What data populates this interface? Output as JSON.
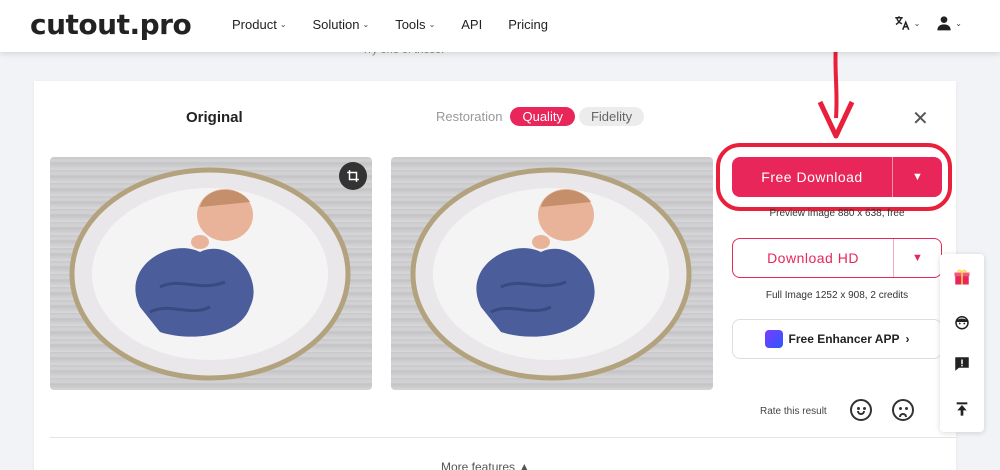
{
  "header": {
    "logo": "cutout.pro",
    "nav": [
      "Product",
      "Solution",
      "Tools",
      "API",
      "Pricing"
    ],
    "nav_has_caret": [
      true,
      true,
      true,
      false,
      false
    ]
  },
  "try_one": "Try one of these:",
  "card": {
    "original_title": "Original",
    "tabs": {
      "label": "Restoration",
      "active": "Quality",
      "inactive": "Fidelity"
    }
  },
  "panel": {
    "free_download": "Free Download",
    "preview_note": "Preview image 880 x 638, free",
    "download_hd": "Download HD",
    "full_note": "Full Image 1252 x 908, 2 credits",
    "app_button": "Free Enhancer APP",
    "app_chevron": "›",
    "rate_label": "Rate this result"
  },
  "more_features": "More features",
  "colors": {
    "accent": "#e8265a",
    "highlight": "#e8203c"
  },
  "icons": [
    "translate-icon",
    "user-icon",
    "crop-icon",
    "close-icon",
    "gift-icon",
    "support-icon",
    "feedback-icon",
    "back-to-top-icon",
    "smile-icon",
    "sad-icon"
  ]
}
